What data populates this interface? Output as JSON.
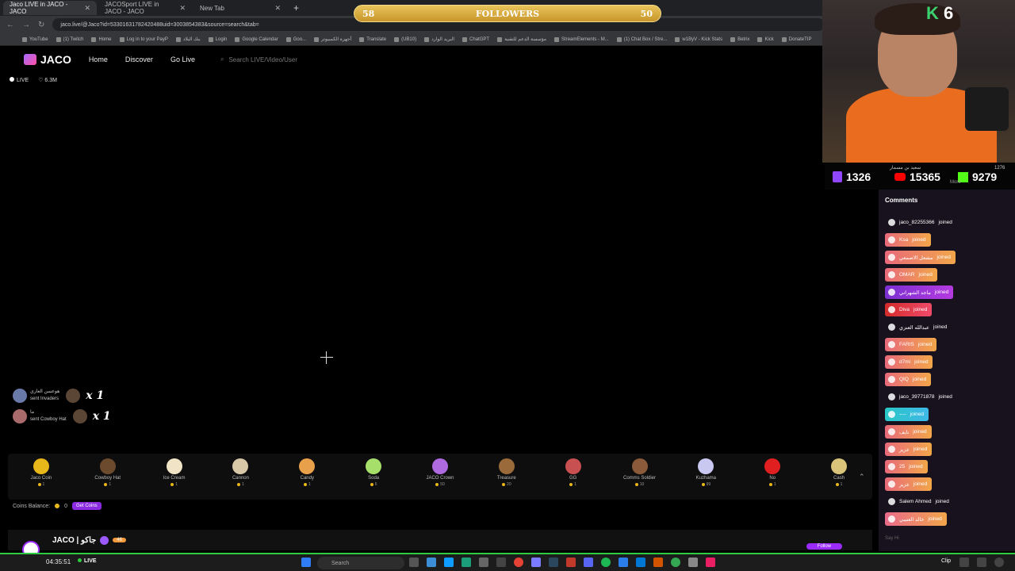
{
  "browser": {
    "tabs": [
      {
        "label": "Jaco LIVE in JACO - JACO",
        "active": true
      },
      {
        "label": "JACOSport LIVE in JACO - JACO",
        "active": false
      },
      {
        "label": "New Tab",
        "active": false
      }
    ],
    "url": "jaco.live/@Jaco?id=53301631782420488uid=3003854383&source=search&tab=",
    "bookmarks": [
      "YouTube",
      "(1) Twitch",
      "Home",
      "Log in to your PayP",
      "بنك البلاد",
      "Login",
      "Google Calendar",
      "Goo...",
      "أجهزة الكمبيوتر",
      "Translate",
      "(UB10)",
      "البريد الوارد",
      "ChatGPT",
      "مؤسسة الدعم للتقنية",
      "StreamElements - M...",
      "(1) Chat Box / Stre...",
      "w1ByV - Kick Stats",
      "Betrix",
      "Kick",
      "DonateTIP"
    ]
  },
  "followers_banner": {
    "left": "58",
    "label": "FOLLOWERS",
    "right": "50"
  },
  "site": {
    "logo": "JACO",
    "nav": [
      "Home",
      "Discover",
      "Go Live"
    ],
    "search_placeholder": "Search LIVE/Video/User",
    "live_label": "LIVE",
    "likes": "6.3M"
  },
  "gift_notifications": [
    {
      "user": "هوعسن العازي",
      "action": "sent Invaders",
      "mult": "x 1"
    },
    {
      "user": "ما",
      "action": "sent Cowboy Hat",
      "mult": "x 1"
    }
  ],
  "gifts": [
    {
      "name": "Jaco Coin",
      "price": "1",
      "color": "#e8b71a"
    },
    {
      "name": "Cowboy Hat",
      "price": "1",
      "color": "#6b4a2e"
    },
    {
      "name": "Ice Cream",
      "price": "1",
      "color": "#f1e3c6"
    },
    {
      "name": "Cannon",
      "price": "1",
      "color": "#d9c8a8"
    },
    {
      "name": "Candy",
      "price": "1",
      "color": "#e9a04a"
    },
    {
      "name": "Soda",
      "price": "6",
      "color": "#a6e06a"
    },
    {
      "name": "JACO Crown",
      "price": "50",
      "color": "#b06adf"
    },
    {
      "name": "Treasure",
      "price": "20",
      "color": "#9a6a3a"
    },
    {
      "name": "GG",
      "price": "1",
      "color": "#c85050"
    },
    {
      "name": "Comms Soldier",
      "price": "10",
      "color": "#8a5a3a"
    },
    {
      "name": "Kuzhama",
      "price": "99",
      "color": "#c8c8f0"
    },
    {
      "name": "No",
      "price": "1",
      "color": "#e02020"
    },
    {
      "name": "Cash",
      "price": "1",
      "color": "#d9c47a"
    }
  ],
  "coins": {
    "label": "Coins Balance:",
    "value": "0",
    "button": "Get Coins"
  },
  "streamer": {
    "name": "JACO | جاكو",
    "level": "46",
    "follow_label": "Follow"
  },
  "cam": {
    "tag_letter": "K",
    "tag_number": "6"
  },
  "stats": {
    "twitch": "1326",
    "youtube": "15365",
    "kick": "9279",
    "overlay_name": "سعيد بن مسمار",
    "overlay_count": "1276",
    "more": "More"
  },
  "comments": {
    "header": "Comments",
    "rows": [
      {
        "user": "jaco_82255366",
        "text": "joined",
        "style": "plain"
      },
      {
        "user": "Ksa",
        "text": "joined",
        "style": "orange"
      },
      {
        "user": "مشعل الاصمعي",
        "text": "joined",
        "style": "orange"
      },
      {
        "user": "OMAR",
        "text": "joined",
        "style": "orange"
      },
      {
        "user": "ماجد الشهراني",
        "text": "joined",
        "style": "purple"
      },
      {
        "user": "Diva",
        "text": "joined",
        "style": "red"
      },
      {
        "user": "عبدالله العنزي",
        "text": "joined",
        "style": "plain"
      },
      {
        "user": "FARIS",
        "text": "joined",
        "style": "orange"
      },
      {
        "user": "d7mi",
        "text": "joined",
        "style": "orange"
      },
      {
        "user": "QIQ",
        "text": "joined",
        "style": "orange"
      },
      {
        "user": "jaco_39771878",
        "text": "joined",
        "style": "plain"
      },
      {
        "user": "----",
        "text": "joined",
        "style": "teal"
      },
      {
        "user": "نايف",
        "text": "joined",
        "style": "orange"
      },
      {
        "user": "عزيز",
        "text": "joined",
        "style": "orange"
      },
      {
        "user": "25",
        "text": "joined",
        "style": "orange"
      },
      {
        "user": "عزيز",
        "text": "joined",
        "style": "orange"
      },
      {
        "user": "Salem Ahmed",
        "text": "joined",
        "style": "plain"
      },
      {
        "user": "خالد العتيبي",
        "text": "joined",
        "style": "pink"
      }
    ],
    "input_placeholder": "Say Hi"
  },
  "taskbar": {
    "time": "04:35:51",
    "live": "LIVE",
    "search": "Search",
    "clip": "Clip"
  }
}
